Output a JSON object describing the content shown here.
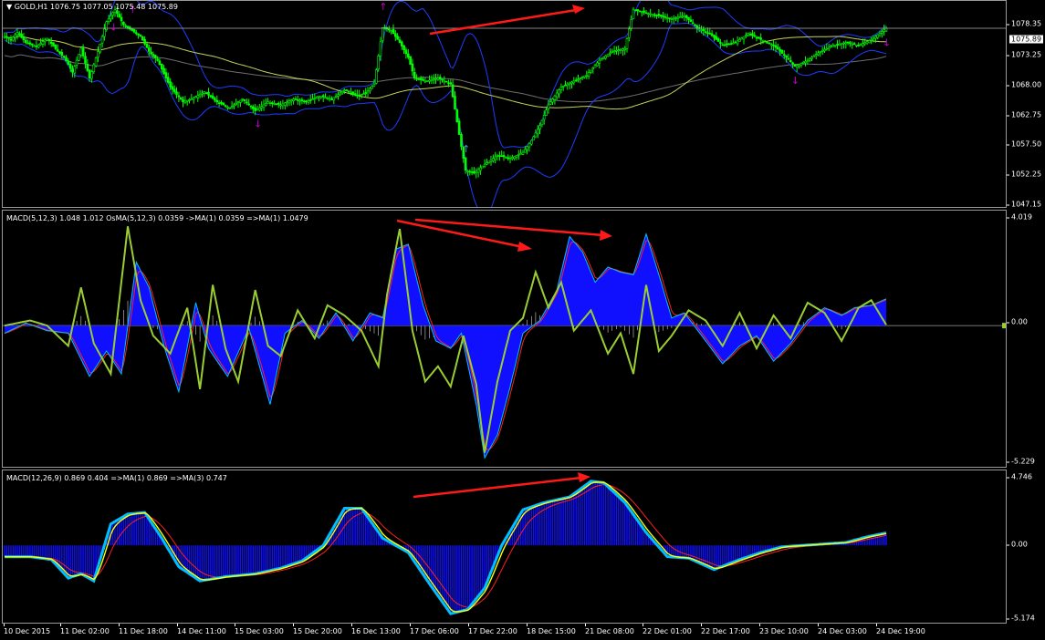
{
  "symbol_header": "GOLD,H1  1076.75 1077.05 1075.48 1075.89",
  "current_price": "1075.89",
  "colors": {
    "background": "#000000",
    "candle": "#00ff00",
    "bollinger": "#1e3cff",
    "ma_slow": "#c8d25a",
    "ma_long": "#6e6e6e",
    "arrow": "#ff1a1a",
    "histogram": "#1010ff",
    "signal": "#ff2020",
    "oscillator": "#9acd32",
    "macd_line": "#00bfff",
    "ma_line": "#ffff00",
    "fractal_up": "#c000c0",
    "fractal_down": "#3aa0c0"
  },
  "panes": {
    "price": {
      "ticks": [
        "1078.35",
        "1073.25",
        "1068.00",
        "1062.75",
        "1057.50",
        "1052.25",
        "1047.15"
      ]
    },
    "macd_fast": {
      "label": "MACD(5,12,3) 1.048 1.012  OsMA(5,12,3) 0.0359  ->MA(1) 0.0359  =>MA(1) 1.0479",
      "ticks": [
        "4.019",
        "0.00",
        "-5.229"
      ]
    },
    "macd_slow": {
      "label": "MACD(12,26,9) 0.869 0.404  =>MA(1) 0.869  =>MA(3) 0.747",
      "ticks": [
        "4.746",
        "0.00",
        "-5.174"
      ]
    }
  },
  "time_axis": [
    "10 Dec 2015",
    "11 Dec 02:00",
    "11 Dec 18:00",
    "14 Dec 11:00",
    "15 Dec 03:00",
    "15 Dec 20:00",
    "16 Dec 13:00",
    "17 Dec 06:00",
    "17 Dec 22:00",
    "18 Dec 15:00",
    "21 Dec 08:00",
    "22 Dec 01:00",
    "22 Dec 17:00",
    "23 Dec 10:00",
    "24 Dec 03:00",
    "24 Dec 19:00"
  ],
  "chart_data": [
    {
      "type": "candlestick",
      "title": "GOLD,H1",
      "ylim": [
        1045.5,
        1080.5
      ],
      "x_labels": [
        "10 Dec 2015",
        "11 Dec 02:00",
        "11 Dec 18:00",
        "14 Dec 11:00",
        "15 Dec 03:00",
        "15 Dec 20:00",
        "16 Dec 13:00",
        "17 Dec 06:00",
        "17 Dec 22:00",
        "18 Dec 15:00",
        "21 Dec 08:00",
        "22 Dec 01:00",
        "22 Dec 17:00",
        "23 Dec 10:00",
        "24 Dec 03:00",
        "24 Dec 19:00"
      ],
      "close_anchors": [
        [
          0,
          1074.5
        ],
        [
          3,
          1074.0
        ],
        [
          6,
          1075.2
        ],
        [
          10,
          1073.5
        ],
        [
          15,
          1072.8
        ],
        [
          20,
          1074.2
        ],
        [
          25,
          1072.0
        ],
        [
          28,
          1071.0
        ],
        [
          32,
          1068.5
        ],
        [
          36,
          1072.5
        ],
        [
          40,
          1067.5
        ],
        [
          44,
          1072.0
        ],
        [
          48,
          1077.0
        ],
        [
          52,
          1079.0
        ],
        [
          56,
          1076.5
        ],
        [
          60,
          1075.5
        ],
        [
          64,
          1074.5
        ],
        [
          68,
          1072.0
        ],
        [
          72,
          1070.5
        ],
        [
          78,
          1066.0
        ],
        [
          84,
          1063.5
        ],
        [
          88,
          1064.0
        ],
        [
          94,
          1065.2
        ],
        [
          100,
          1063.5
        ],
        [
          106,
          1062.5
        ],
        [
          112,
          1064.0
        ],
        [
          118,
          1062.0
        ],
        [
          124,
          1063.5
        ],
        [
          130,
          1063.0
        ],
        [
          136,
          1064.0
        ],
        [
          142,
          1063.5
        ],
        [
          148,
          1064.5
        ],
        [
          154,
          1064.0
        ],
        [
          160,
          1065.5
        ],
        [
          166,
          1064.5
        ],
        [
          170,
          1065.0
        ],
        [
          174,
          1066.5
        ],
        [
          178,
          1076.0
        ],
        [
          182,
          1075.5
        ],
        [
          186,
          1073.5
        ],
        [
          190,
          1071.0
        ],
        [
          193,
          1067.5
        ],
        [
          198,
          1067.0
        ],
        [
          204,
          1067.5
        ],
        [
          210,
          1066.5
        ],
        [
          214,
          1058.0
        ],
        [
          217,
          1052.0
        ],
        [
          221,
          1051.5
        ],
        [
          226,
          1053.0
        ],
        [
          232,
          1054.5
        ],
        [
          238,
          1054.0
        ],
        [
          244,
          1055.0
        ],
        [
          248,
          1057.0
        ],
        [
          252,
          1059.5
        ],
        [
          256,
          1063.0
        ],
        [
          262,
          1066.0
        ],
        [
          268,
          1067.0
        ],
        [
          274,
          1068.0
        ],
        [
          280,
          1070.5
        ],
        [
          286,
          1072.0
        ],
        [
          292,
          1072.5
        ],
        [
          296,
          1079.0
        ],
        [
          302,
          1078.5
        ],
        [
          308,
          1078.0
        ],
        [
          314,
          1077.5
        ],
        [
          320,
          1078.0
        ],
        [
          326,
          1076.0
        ],
        [
          332,
          1075.0
        ],
        [
          338,
          1073.0
        ],
        [
          344,
          1073.5
        ],
        [
          350,
          1075.0
        ],
        [
          356,
          1074.0
        ],
        [
          362,
          1073.0
        ],
        [
          368,
          1071.0
        ],
        [
          372,
          1069.5
        ],
        [
          378,
          1070.5
        ],
        [
          384,
          1072.0
        ],
        [
          390,
          1073.0
        ],
        [
          396,
          1073.5
        ],
        [
          402,
          1073.0
        ],
        [
          408,
          1074.0
        ],
        [
          415,
          1075.89
        ]
      ],
      "bars": 416,
      "current": 1075.89
    },
    {
      "type": "area",
      "title": "MACD(5,12,3) OsMA(5,12,3)",
      "ylim": [
        -5.229,
        4.019
      ],
      "macd_anchors": [
        [
          0,
          -0.3
        ],
        [
          10,
          0.1
        ],
        [
          20,
          -0.2
        ],
        [
          30,
          -0.3
        ],
        [
          40,
          -2.0
        ],
        [
          48,
          -1.0
        ],
        [
          55,
          -1.9
        ],
        [
          62,
          2.5
        ],
        [
          68,
          1.5
        ],
        [
          75,
          -0.8
        ],
        [
          82,
          -2.6
        ],
        [
          90,
          0.9
        ],
        [
          96,
          -0.9
        ],
        [
          105,
          -2.0
        ],
        [
          115,
          -0.1
        ],
        [
          125,
          -3.1
        ],
        [
          132,
          -0.3
        ],
        [
          140,
          0.2
        ],
        [
          148,
          -0.5
        ],
        [
          156,
          0.5
        ],
        [
          164,
          -0.6
        ],
        [
          172,
          0.5
        ],
        [
          178,
          0.3
        ],
        [
          184,
          3.0
        ],
        [
          190,
          3.2
        ],
        [
          197,
          0.8
        ],
        [
          203,
          -0.6
        ],
        [
          210,
          -0.9
        ],
        [
          215,
          -0.3
        ],
        [
          222,
          -3.1
        ],
        [
          226,
          -5.2
        ],
        [
          232,
          -4.3
        ],
        [
          238,
          -2.4
        ],
        [
          244,
          -0.3
        ],
        [
          252,
          0.2
        ],
        [
          260,
          1.4
        ],
        [
          266,
          3.5
        ],
        [
          272,
          2.9
        ],
        [
          278,
          1.7
        ],
        [
          284,
          2.3
        ],
        [
          290,
          2.1
        ],
        [
          296,
          2.0
        ],
        [
          302,
          3.6
        ],
        [
          308,
          2.0
        ],
        [
          314,
          0.3
        ],
        [
          320,
          0.5
        ],
        [
          330,
          -0.6
        ],
        [
          338,
          -1.5
        ],
        [
          346,
          -0.8
        ],
        [
          354,
          -0.4
        ],
        [
          362,
          -1.4
        ],
        [
          370,
          -0.7
        ],
        [
          378,
          0.2
        ],
        [
          386,
          0.7
        ],
        [
          394,
          0.4
        ],
        [
          400,
          0.7
        ],
        [
          408,
          0.8
        ],
        [
          415,
          1.05
        ]
      ],
      "oscillator_anchors": [
        [
          0,
          0.0
        ],
        [
          12,
          0.2
        ],
        [
          20,
          0.0
        ],
        [
          30,
          -0.8
        ],
        [
          36,
          1.5
        ],
        [
          42,
          -0.7
        ],
        [
          50,
          -1.9
        ],
        [
          58,
          3.9
        ],
        [
          64,
          1.0
        ],
        [
          70,
          -0.4
        ],
        [
          78,
          -1.1
        ],
        [
          86,
          0.7
        ],
        [
          92,
          -2.5
        ],
        [
          98,
          1.6
        ],
        [
          104,
          -0.9
        ],
        [
          110,
          -2.2
        ],
        [
          118,
          1.4
        ],
        [
          124,
          -0.8
        ],
        [
          130,
          -1.2
        ],
        [
          138,
          0.6
        ],
        [
          146,
          -0.5
        ],
        [
          152,
          0.8
        ],
        [
          160,
          0.4
        ],
        [
          168,
          -0.2
        ],
        [
          176,
          -1.6
        ],
        [
          180,
          1.2
        ],
        [
          186,
          3.8
        ],
        [
          192,
          -0.2
        ],
        [
          198,
          -2.2
        ],
        [
          204,
          -1.6
        ],
        [
          210,
          -2.4
        ],
        [
          216,
          -0.4
        ],
        [
          222,
          -2.3
        ],
        [
          226,
          -5.0
        ],
        [
          232,
          -2.2
        ],
        [
          238,
          -0.2
        ],
        [
          244,
          0.3
        ],
        [
          250,
          2.1
        ],
        [
          256,
          0.7
        ],
        [
          262,
          1.7
        ],
        [
          268,
          -0.2
        ],
        [
          276,
          0.6
        ],
        [
          284,
          -1.1
        ],
        [
          290,
          -0.3
        ],
        [
          296,
          -1.9
        ],
        [
          302,
          1.6
        ],
        [
          308,
          -1.0
        ],
        [
          314,
          -0.4
        ],
        [
          322,
          0.6
        ],
        [
          330,
          0.2
        ],
        [
          338,
          -0.8
        ],
        [
          346,
          0.5
        ],
        [
          354,
          -0.9
        ],
        [
          362,
          0.4
        ],
        [
          370,
          -0.5
        ],
        [
          378,
          0.9
        ],
        [
          386,
          0.5
        ],
        [
          394,
          -0.6
        ],
        [
          402,
          0.7
        ],
        [
          408,
          1.0
        ],
        [
          415,
          0.03
        ]
      ]
    },
    {
      "type": "area",
      "title": "MACD(12,26,9)",
      "ylim": [
        -5.174,
        4.746
      ],
      "macd_anchors": [
        [
          0,
          -0.8
        ],
        [
          12,
          -0.8
        ],
        [
          22,
          -1.0
        ],
        [
          30,
          -2.3
        ],
        [
          36,
          -2.0
        ],
        [
          42,
          -2.5
        ],
        [
          50,
          1.5
        ],
        [
          58,
          2.2
        ],
        [
          66,
          2.3
        ],
        [
          74,
          0.5
        ],
        [
          82,
          -1.5
        ],
        [
          92,
          -2.5
        ],
        [
          104,
          -2.2
        ],
        [
          118,
          -2.0
        ],
        [
          130,
          -1.6
        ],
        [
          140,
          -1.1
        ],
        [
          150,
          0.0
        ],
        [
          160,
          2.6
        ],
        [
          168,
          2.6
        ],
        [
          178,
          0.5
        ],
        [
          190,
          -0.5
        ],
        [
          200,
          -2.7
        ],
        [
          210,
          -4.8
        ],
        [
          218,
          -4.5
        ],
        [
          226,
          -3.0
        ],
        [
          234,
          0.0
        ],
        [
          244,
          2.5
        ],
        [
          254,
          3.0
        ],
        [
          266,
          3.4
        ],
        [
          276,
          4.5
        ],
        [
          282,
          4.4
        ],
        [
          292,
          3.0
        ],
        [
          302,
          0.9
        ],
        [
          312,
          -0.8
        ],
        [
          322,
          -0.9
        ],
        [
          334,
          -1.7
        ],
        [
          346,
          -1.0
        ],
        [
          356,
          -0.5
        ],
        [
          366,
          -0.1
        ],
        [
          376,
          0.0
        ],
        [
          386,
          0.1
        ],
        [
          396,
          0.2
        ],
        [
          406,
          0.6
        ],
        [
          415,
          0.87
        ]
      ]
    }
  ]
}
